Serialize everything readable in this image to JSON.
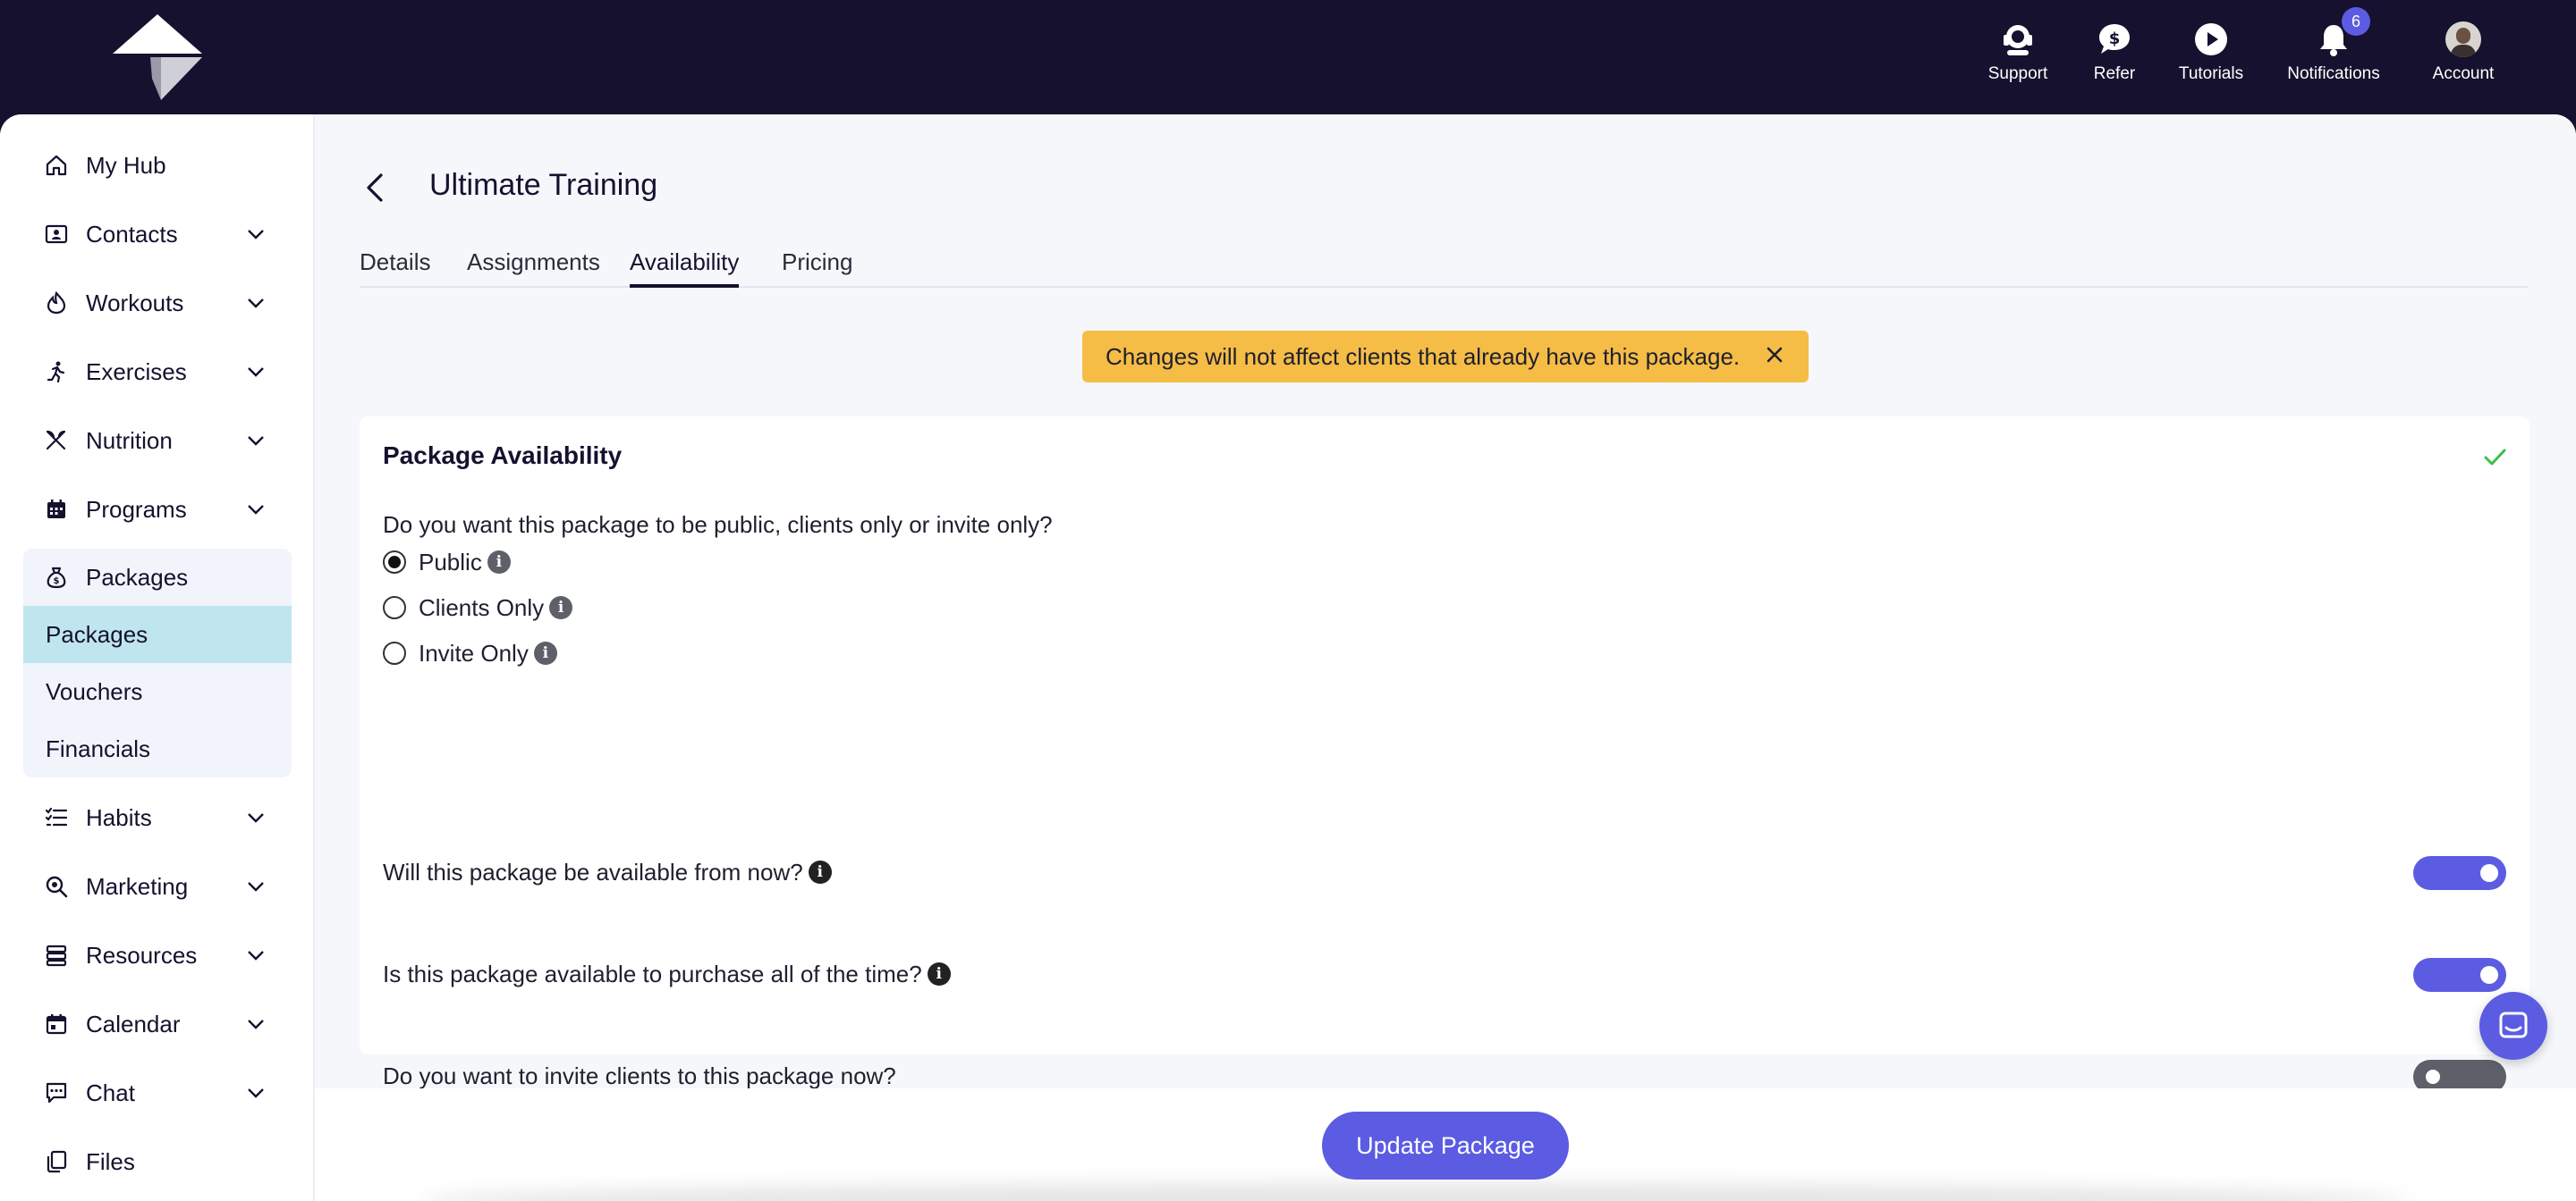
{
  "topnav": {
    "support": "Support",
    "refer": "Refer",
    "tutorials": "Tutorials",
    "notifications": "Notifications",
    "notifications_count": "6",
    "account": "Account"
  },
  "sidebar": {
    "items": [
      {
        "label": "My Hub",
        "icon": "home-icon"
      },
      {
        "label": "Contacts",
        "icon": "contacts-icon"
      },
      {
        "label": "Workouts",
        "icon": "workouts-icon"
      },
      {
        "label": "Exercises",
        "icon": "running-icon"
      },
      {
        "label": "Nutrition",
        "icon": "utensils-icon"
      },
      {
        "label": "Programs",
        "icon": "calendar-grid-icon"
      },
      {
        "label": "Packages",
        "icon": "money-bag-icon"
      },
      {
        "label": "Habits",
        "icon": "checklist-icon"
      },
      {
        "label": "Marketing",
        "icon": "search-icon"
      },
      {
        "label": "Resources",
        "icon": "stack-icon"
      },
      {
        "label": "Calendar",
        "icon": "calendar-icon"
      },
      {
        "label": "Chat",
        "icon": "chat-icon"
      },
      {
        "label": "Files",
        "icon": "files-icon"
      }
    ],
    "packages_sub": [
      "Packages",
      "Vouchers",
      "Financials"
    ]
  },
  "page": {
    "title": "Ultimate Training",
    "tabs": [
      "Details",
      "Assignments",
      "Availability",
      "Pricing"
    ],
    "active_tab": "Availability",
    "banner": "Changes will not affect clients that already have this package."
  },
  "card": {
    "title": "Package Availability",
    "question": "Do you want this package to be public, clients only or invite only?",
    "options": [
      "Public",
      "Clients Only",
      "Invite Only"
    ],
    "selected": "Public",
    "toggles": [
      {
        "label": "Will this package be available from now?",
        "on": true,
        "info": true
      },
      {
        "label": "Is this package available to purchase all of the time?",
        "on": true,
        "info": true
      },
      {
        "label": "Do you want to invite clients to this package now?",
        "on": false,
        "info": false
      }
    ]
  },
  "footer": {
    "update_label": "Update Package"
  },
  "colors": {
    "topbar": "#16112e",
    "accent": "#5b5ce2",
    "banner": "#f5bd46",
    "active_sub": "#bfe6ef",
    "check": "#3cbf4a"
  }
}
